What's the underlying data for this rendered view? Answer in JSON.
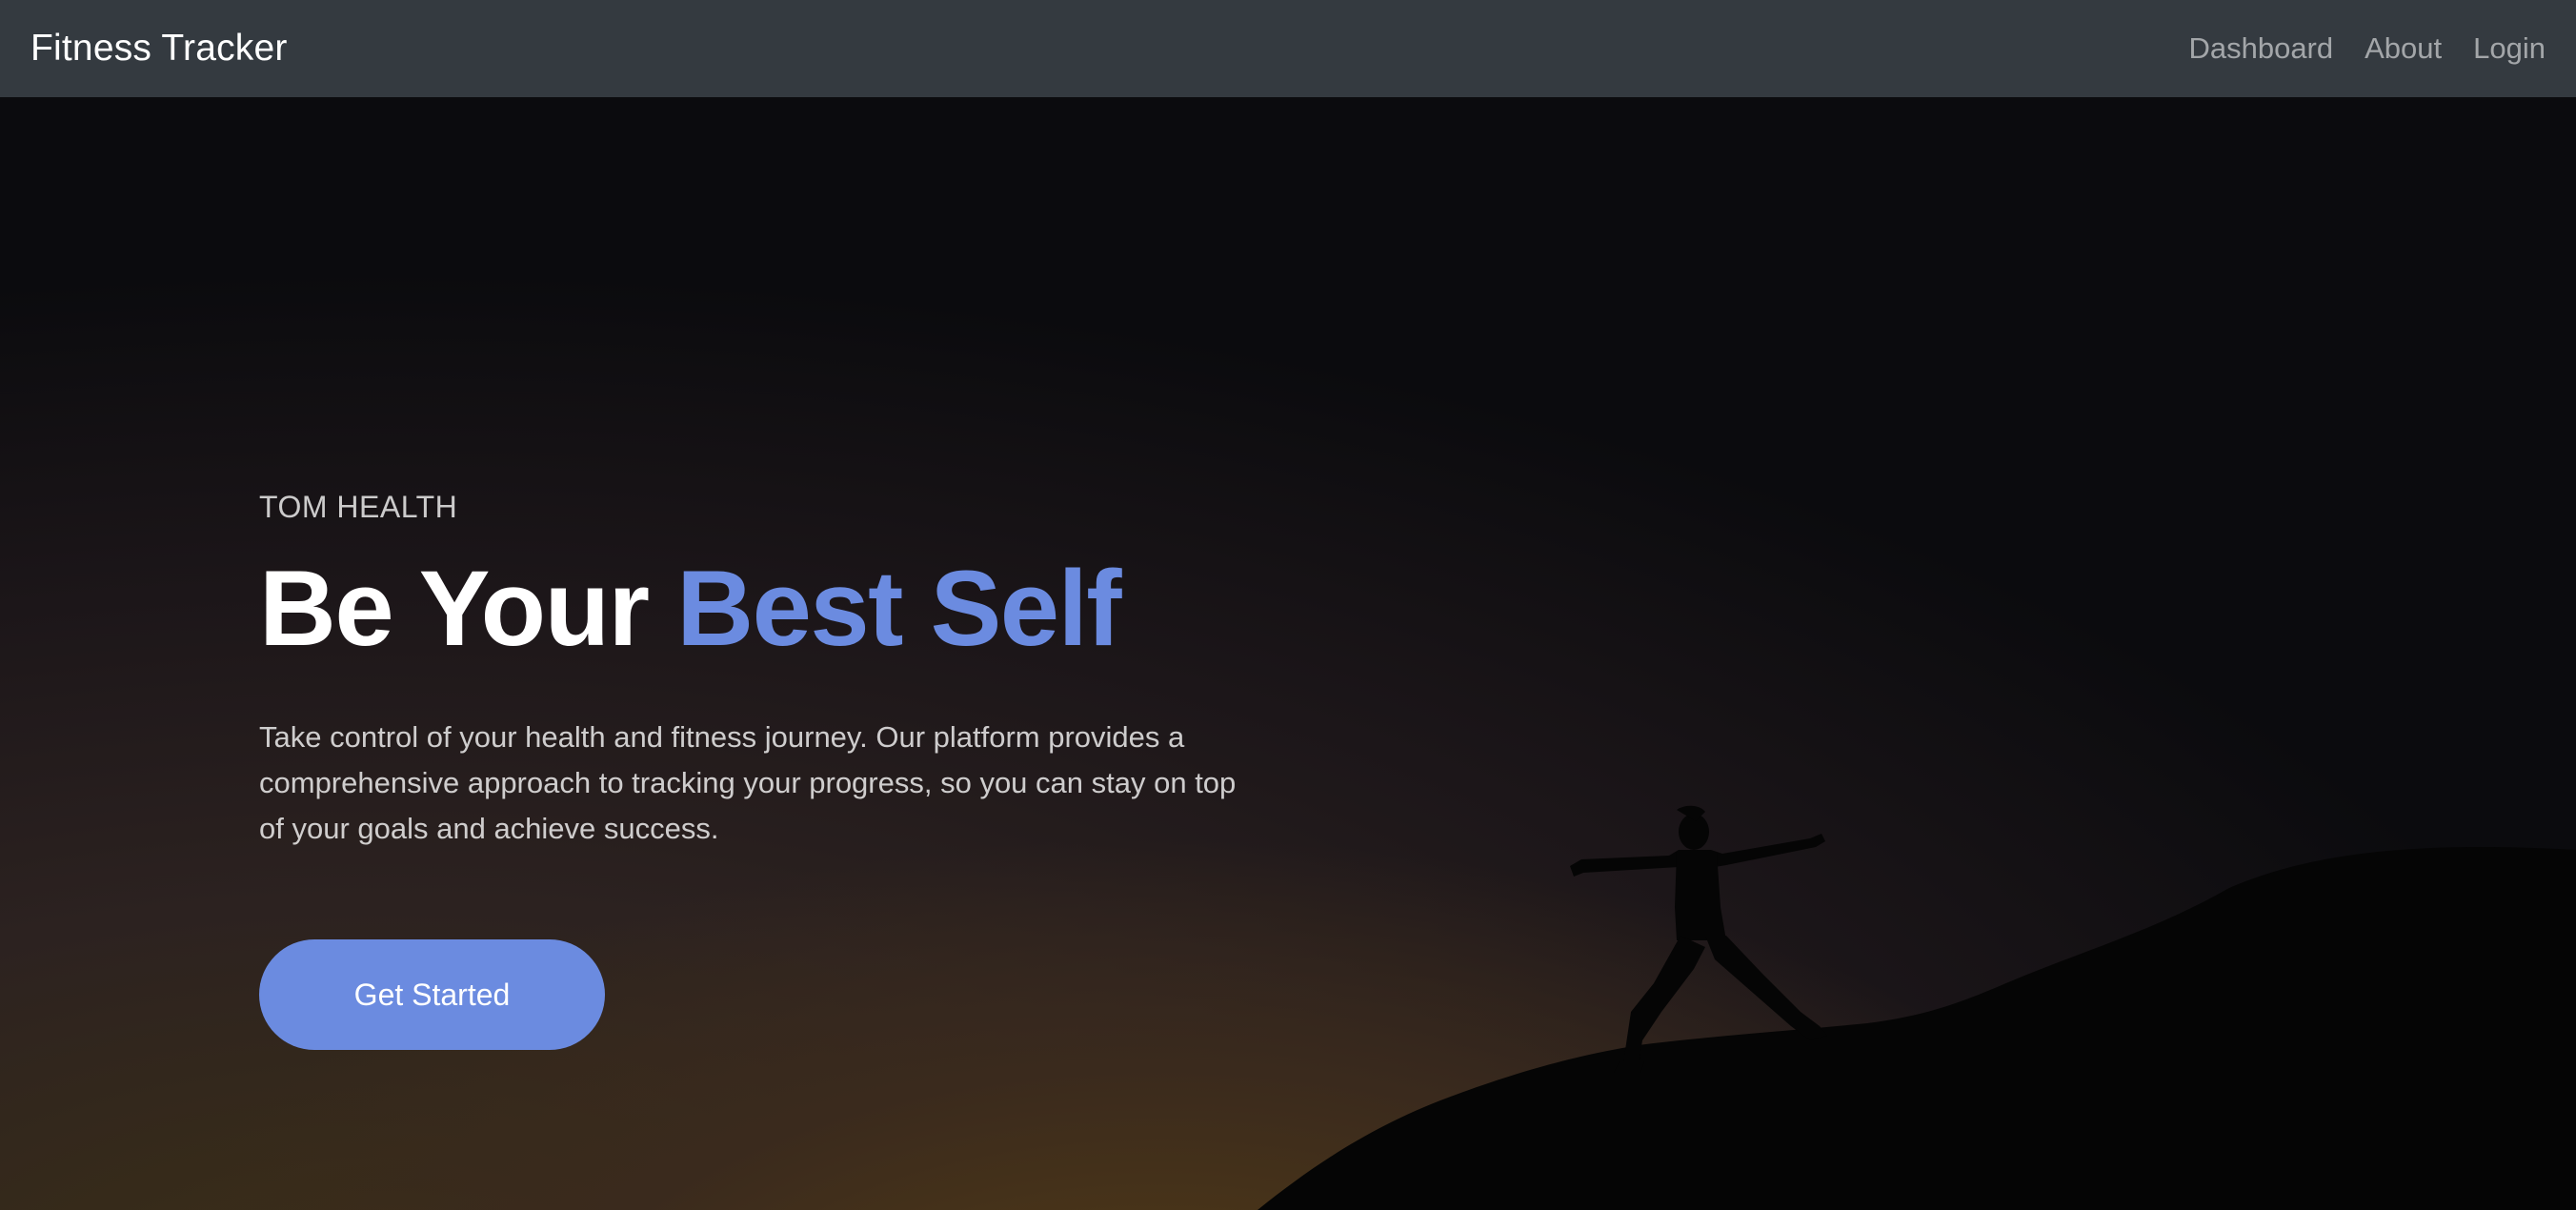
{
  "navbar": {
    "brand": "Fitness Tracker",
    "links": [
      {
        "label": "Dashboard"
      },
      {
        "label": "About"
      },
      {
        "label": "Login"
      }
    ]
  },
  "hero": {
    "eyebrow": "TOM HEALTH",
    "headline_part1": "Be Your",
    "headline_accent": "Best Self",
    "lead": "Take control of your health and fitness journey. Our platform provides a comprehensive approach to tracking your progress, so you can stay on top of your goals and achieve success.",
    "cta_label": "Get Started"
  },
  "colors": {
    "navbar_bg": "#343a40",
    "accent": "#6b8be0",
    "text_light": "#ffffff"
  }
}
